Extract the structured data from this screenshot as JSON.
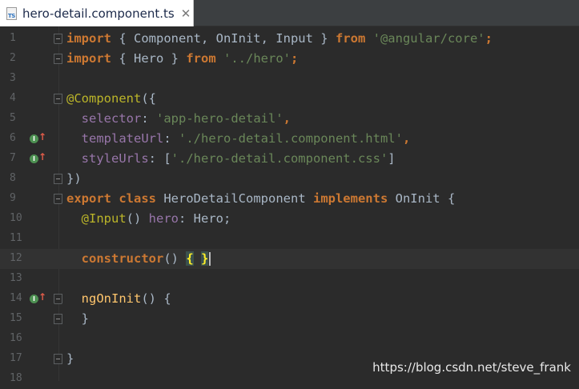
{
  "tab": {
    "title": "hero-detail.component.ts",
    "close": "✕",
    "icon": "TS"
  },
  "gutter": {
    "line_numbers": [
      "1",
      "2",
      "3",
      "4",
      "5",
      "6",
      "7",
      "8",
      "9",
      "10",
      "11",
      "12",
      "13",
      "14",
      "15",
      "16",
      "17",
      "18"
    ]
  },
  "code": {
    "l1": {
      "kw1": "import",
      "t1": " { Component, OnInit, Input } ",
      "kw2": "from",
      "t2": " ",
      "str": "'@angular/core'",
      "end": ";"
    },
    "l2": {
      "kw1": "import",
      "t1": " { Hero } ",
      "kw2": "from",
      "t2": " ",
      "str": "'../hero'",
      "end": ";"
    },
    "l4": {
      "ann": "@Component",
      "t": "({"
    },
    "l5": {
      "indent": "  ",
      "key": "selector",
      "colon": ": ",
      "str": "'app-hero-detail'",
      "end": ","
    },
    "l6": {
      "indent": "  ",
      "key": "templateUrl",
      "colon": ": ",
      "str": "'./hero-detail.component.html'",
      "end": ","
    },
    "l7": {
      "indent": "  ",
      "key": "styleUrls",
      "colon": ": [",
      "str": "'./hero-detail.component.css'",
      "end": "]"
    },
    "l8": {
      "t": "})"
    },
    "l9": {
      "kw1": "export",
      "sp1": " ",
      "kw2": "class",
      "t1": " HeroDetailComponent ",
      "kw3": "implements",
      "t2": " OnInit {"
    },
    "l10": {
      "indent": "  ",
      "ann": "@Input",
      "t1": "() ",
      "field": "hero",
      "t2": ": Hero;"
    },
    "l12": {
      "indent": "  ",
      "kw": "constructor",
      "t1": "() ",
      "b1": "{",
      "sp": " ",
      "b2": "}"
    },
    "l14": {
      "indent": "  ",
      "fn": "ngOnInit",
      "t": "() {"
    },
    "l15": {
      "indent": "  ",
      "t": "}"
    },
    "l17": {
      "t": "}"
    }
  },
  "gutter_markers": {
    "implements_icon": "I",
    "arrow": "↑"
  },
  "watermark": "https://blog.csdn.net/steve_frank",
  "colors": {
    "background": "#2b2b2b",
    "keyword": "#cc7832",
    "string": "#6a8759",
    "annotation": "#bbb529",
    "function": "#ffc66d",
    "field": "#9876aa",
    "text": "#a9b7c6"
  }
}
